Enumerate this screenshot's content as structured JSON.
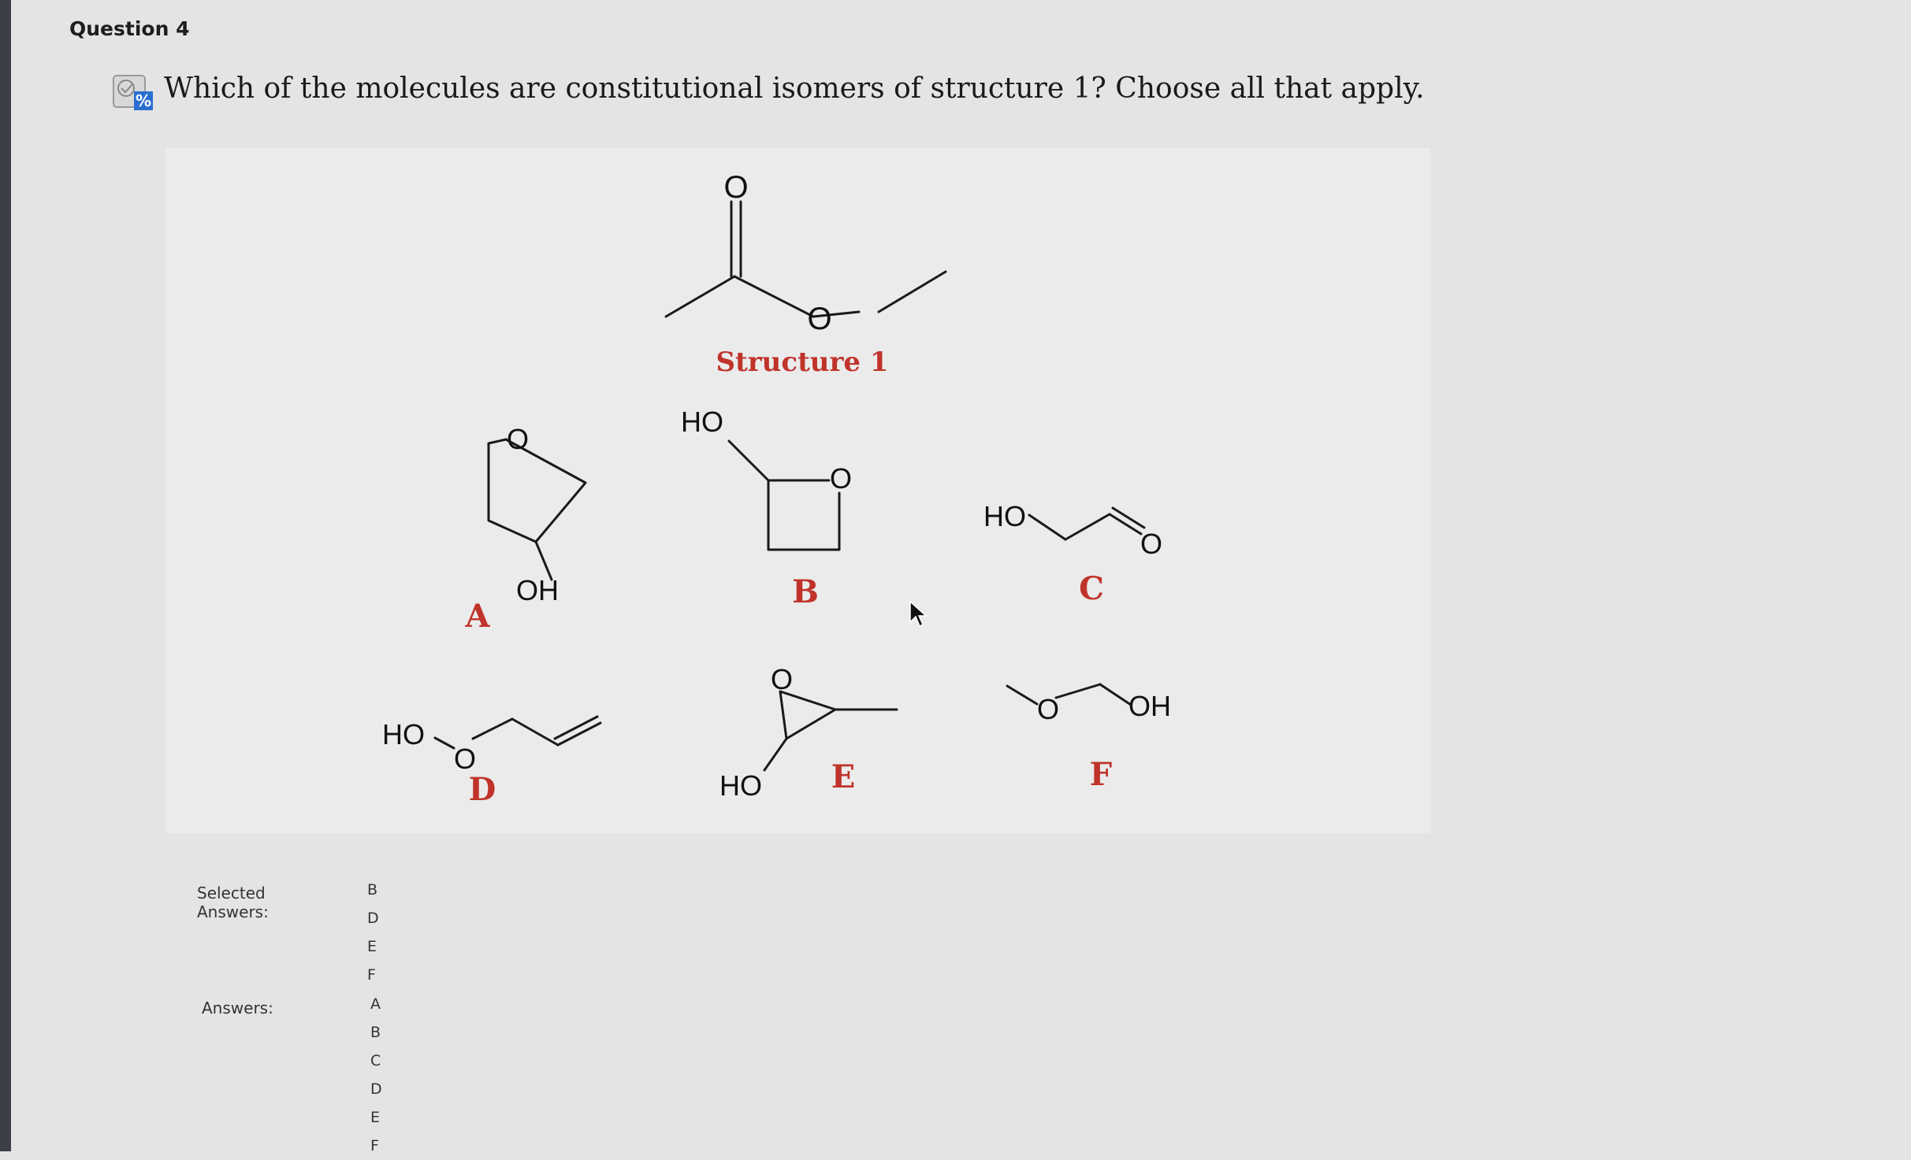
{
  "question": {
    "header": "Question 4",
    "icon": "partial-credit-icon",
    "text": "Which of the molecules are constitutional isomers of structure 1? Choose all that apply."
  },
  "figure": {
    "structure_label": "Structure 1",
    "atoms": {
      "s1_carbonyl_O": "O",
      "s1_ester_O": "O",
      "a_ring_O": "O",
      "a_OH": "OH",
      "b_HO": "HO",
      "b_ring_O": "O",
      "c_HO": "HO",
      "c_O": "O",
      "d_HO": "HO",
      "d_O": "O",
      "e_O": "O",
      "e_HO": "HO",
      "f_O": "O",
      "f_OH": "OH"
    },
    "labels": {
      "a": "A",
      "b": "B",
      "c": "C",
      "d": "D",
      "e": "E",
      "f": "F"
    }
  },
  "selected_answers": {
    "label": "Selected Answers:",
    "items": [
      "B",
      "D",
      "E",
      "F"
    ]
  },
  "answers": {
    "label": "Answers:",
    "items": [
      "A",
      "B",
      "C",
      "D",
      "E",
      "F"
    ]
  },
  "colors": {
    "label_red": "#c0332a",
    "icon_blue": "#2b6fd0"
  }
}
